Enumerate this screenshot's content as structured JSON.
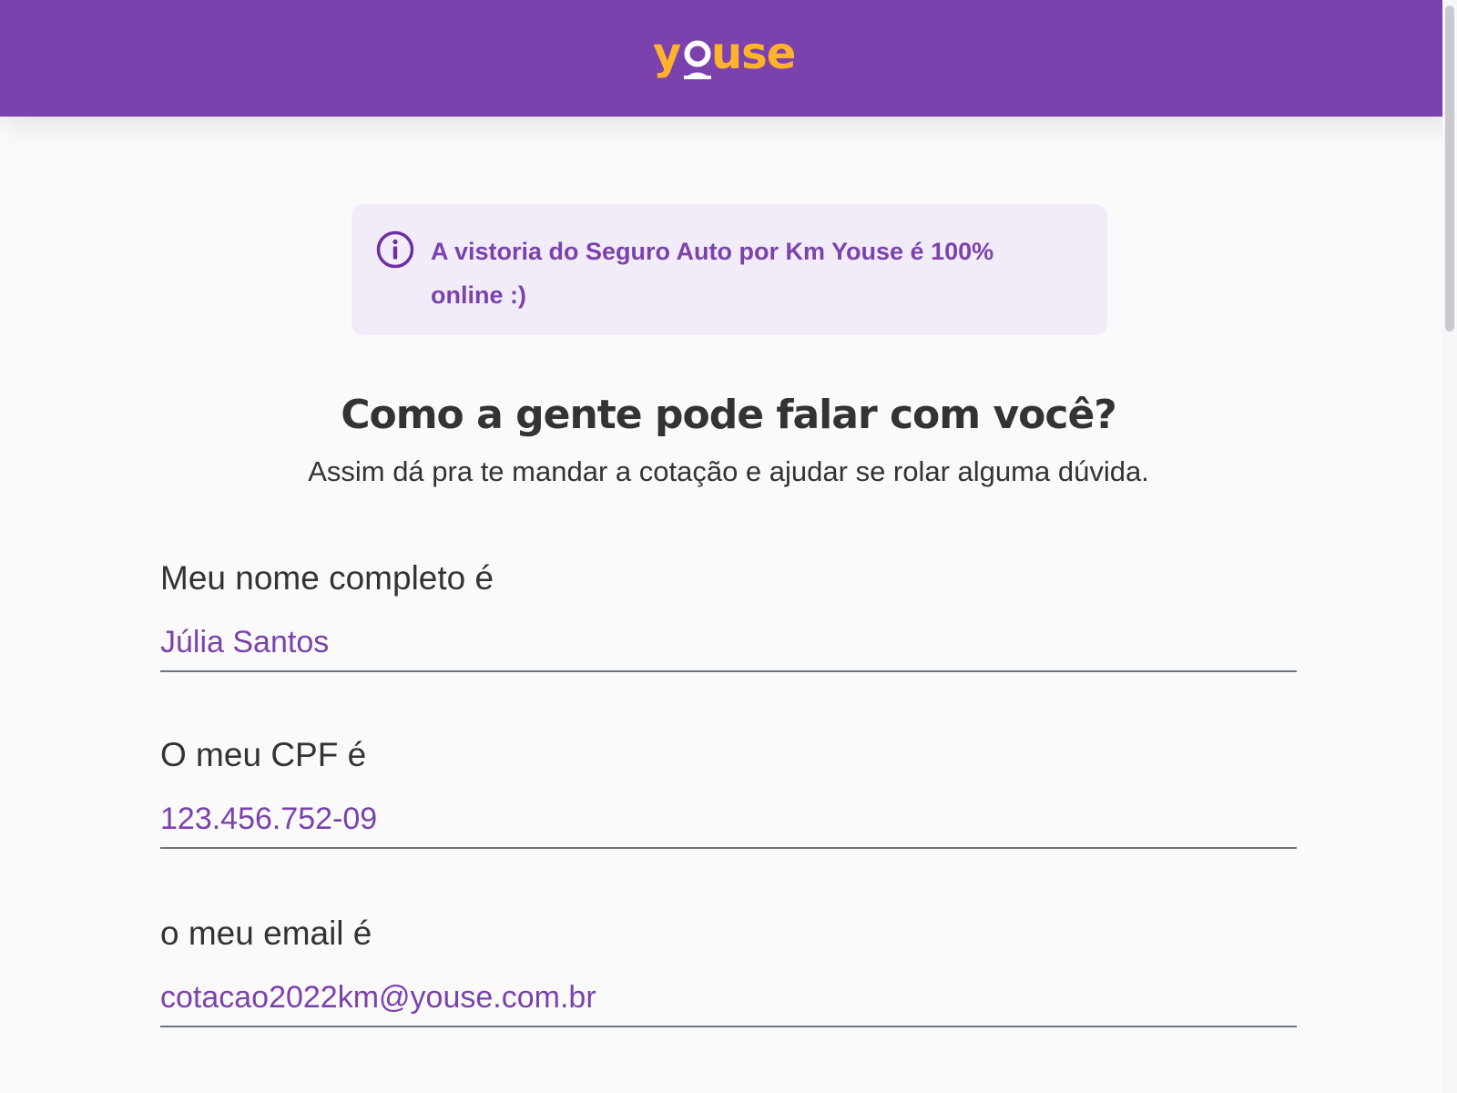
{
  "header": {
    "logo_text": "Youse"
  },
  "colors": {
    "brand_purple": "#7b42ad",
    "logo_yellow": "#ffb32b",
    "banner_bg": "#f2ecf8",
    "text_dark": "#333333",
    "underline": "#6c757d"
  },
  "banner": {
    "icon": "info-icon",
    "text": "A vistoria do Seguro Auto por Km Youse é 100% online :)"
  },
  "main": {
    "title": "Como a gente pode falar com você?",
    "subtitle": "Assim dá pra te mandar a cotação e ajudar se rolar alguma dúvida."
  },
  "form": {
    "fields": [
      {
        "label": "Meu nome completo é",
        "value": "Júlia Santos"
      },
      {
        "label": "O meu CPF é",
        "value": "123.456.752-09"
      },
      {
        "label": "o meu email é",
        "value": "cotacao2022km@youse.com.br"
      }
    ]
  }
}
